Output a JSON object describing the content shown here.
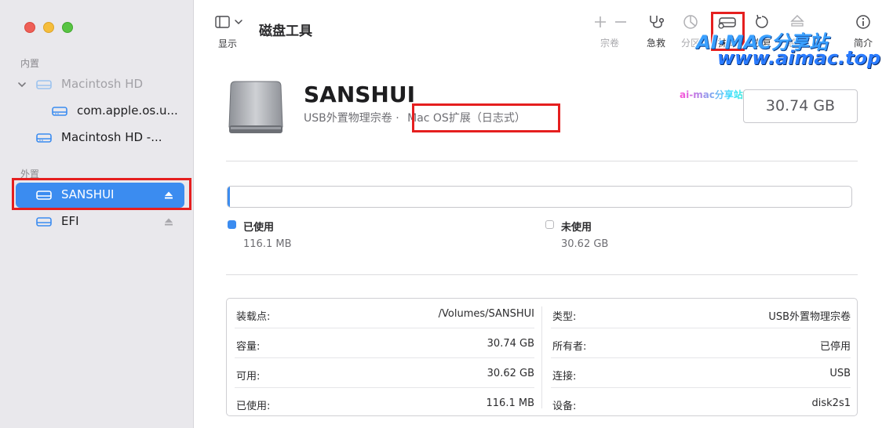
{
  "app": {
    "title": "磁盘工具"
  },
  "toolbar": {
    "view_label": "显示",
    "buttons": [
      {
        "id": "volume",
        "label": "宗卷",
        "icon": "plus-minus-icon",
        "disabled": true
      },
      {
        "id": "first_aid",
        "label": "急救",
        "icon": "stethoscope-icon",
        "disabled": false
      },
      {
        "id": "partition",
        "label": "分区",
        "icon": "pie-chart-icon",
        "disabled": true
      },
      {
        "id": "erase",
        "label": "抹掉",
        "icon": "erase-drive-icon",
        "disabled": false
      },
      {
        "id": "restore",
        "label": "恢复",
        "icon": "restore-icon",
        "disabled": false
      },
      {
        "id": "mount",
        "label": "装载",
        "icon": "eject-icon",
        "disabled": true
      },
      {
        "id": "info",
        "label": "简介",
        "icon": "info-icon",
        "disabled": false
      }
    ]
  },
  "sidebar": {
    "internal_label": "内置",
    "external_label": "外置",
    "items": [
      {
        "label": "Macintosh HD",
        "type": "internal",
        "dimmed": true
      },
      {
        "label": "com.apple.os.u...",
        "type": "internal",
        "dimmed": false
      },
      {
        "label": "Macintosh HD -...",
        "type": "internal",
        "dimmed": false
      },
      {
        "label": "SANSHUI",
        "type": "external",
        "selected": true
      },
      {
        "label": "EFI",
        "type": "external",
        "selected": false
      }
    ]
  },
  "volume": {
    "name": "SANSHUI",
    "kind": "USB外置物理宗卷",
    "separator": "·",
    "format": "Mac OS扩展（日志式）",
    "capacity": "30.74 GB"
  },
  "usage": {
    "used_fraction": 0.0038,
    "used_label": "已使用",
    "used_value": "116.1 MB",
    "free_label": "未使用",
    "free_value": "30.62 GB"
  },
  "info": {
    "left": [
      {
        "key": "装载点:",
        "value": "/Volumes/SANSHUI"
      },
      {
        "key": "容量:",
        "value": "30.74 GB"
      },
      {
        "key": "可用:",
        "value": "30.62 GB"
      },
      {
        "key": "已使用:",
        "value": "116.1 MB"
      }
    ],
    "right": [
      {
        "key": "类型:",
        "value": "USB外置物理宗卷"
      },
      {
        "key": "所有者:",
        "value": "已停用"
      },
      {
        "key": "连接:",
        "value": "USB"
      },
      {
        "key": "设备:",
        "value": "disk2s1"
      }
    ]
  },
  "watermark": {
    "line1": "AI·MAC分享站",
    "line2": "www.aimac.top",
    "line3": "ai-mac分享站原创，转载请注明出处"
  },
  "colors": {
    "accent": "#3b8cf0",
    "highlight_box": "#e51f1f",
    "sidebar_bg": "#e9e8ec"
  }
}
